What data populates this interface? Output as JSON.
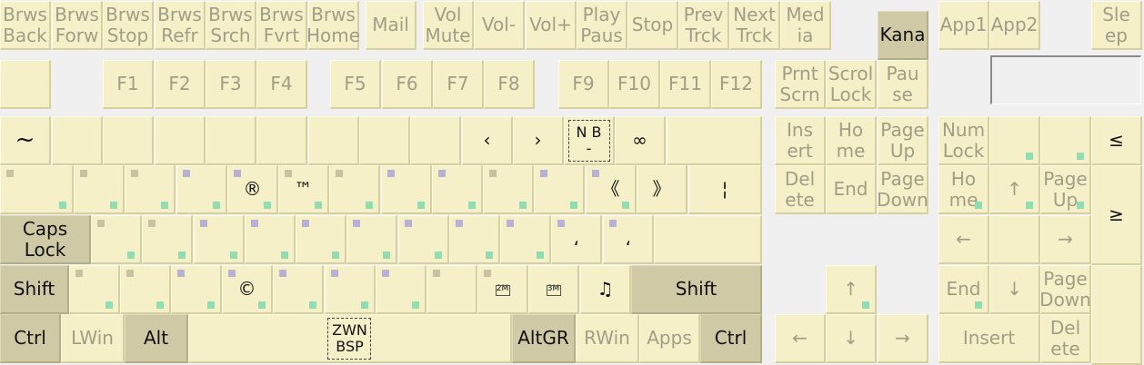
{
  "keys": [
    {
      "name": "browser-back-key",
      "label": "Brws\nBack"
    },
    {
      "name": "browser-forward-key",
      "label": "Brws\nForw"
    },
    {
      "name": "browser-stop-key",
      "label": "Brws\nStop"
    },
    {
      "name": "browser-refresh-key",
      "label": "Brws\nRefr"
    },
    {
      "name": "browser-search-key",
      "label": "Brws\nSrch"
    },
    {
      "name": "browser-favorites-key",
      "label": "Brws\nFvrt"
    },
    {
      "name": "browser-home-key",
      "label": "Brws\nHome"
    },
    {
      "name": "mail-key",
      "label": "Mail"
    },
    {
      "name": "volume-mute-key",
      "label": "Vol\nMute"
    },
    {
      "name": "volume-down-key",
      "label": "Vol-"
    },
    {
      "name": "volume-up-key",
      "label": "Vol+"
    },
    {
      "name": "play-pause-key",
      "label": "Play\nPaus"
    },
    {
      "name": "stop-key",
      "label": "Stop"
    },
    {
      "name": "previous-track-key",
      "label": "Prev\nTrck"
    },
    {
      "name": "next-track-key",
      "label": "Next\nTrck"
    },
    {
      "name": "media-key",
      "label": "Med\nia"
    },
    {
      "name": "kana-key",
      "label": "Kana",
      "dark": true
    },
    {
      "name": "app1-key",
      "label": "App1"
    },
    {
      "name": "app2-key",
      "label": "App2"
    },
    {
      "name": "sleep-key",
      "label": "Sle\nep"
    },
    {
      "name": "escape-key",
      "label": ""
    },
    {
      "name": "f1-key",
      "label": "F1"
    },
    {
      "name": "f2-key",
      "label": "F2"
    },
    {
      "name": "f3-key",
      "label": "F3"
    },
    {
      "name": "f4-key",
      "label": "F4"
    },
    {
      "name": "f5-key",
      "label": "F5"
    },
    {
      "name": "f6-key",
      "label": "F6"
    },
    {
      "name": "f7-key",
      "label": "F7"
    },
    {
      "name": "f8-key",
      "label": "F8"
    },
    {
      "name": "f9-key",
      "label": "F9"
    },
    {
      "name": "f10-key",
      "label": "F10"
    },
    {
      "name": "f11-key",
      "label": "F11"
    },
    {
      "name": "f12-key",
      "label": "F12"
    },
    {
      "name": "print-screen-key",
      "label": "Prnt\nScrn"
    },
    {
      "name": "scroll-lock-key",
      "label": "Scrol\nLock"
    },
    {
      "name": "pause-key",
      "label": "Pau\nse"
    },
    {
      "name": "grave-key",
      "label": "~",
      "black": true,
      "big": true
    },
    {
      "name": "digit1-key",
      "label": ""
    },
    {
      "name": "digit2-key",
      "label": ""
    },
    {
      "name": "digit3-key",
      "label": ""
    },
    {
      "name": "digit4-key",
      "label": ""
    },
    {
      "name": "digit5-key",
      "label": ""
    },
    {
      "name": "digit6-key",
      "label": ""
    },
    {
      "name": "digit7-key",
      "label": ""
    },
    {
      "name": "digit8-key",
      "label": ""
    },
    {
      "name": "digit9-key",
      "label": "‹",
      "black": true
    },
    {
      "name": "digit0-key",
      "label": "›",
      "black": true
    },
    {
      "name": "minus-key",
      "label": "N B\n-",
      "black": true,
      "dash": true
    },
    {
      "name": "equal-key",
      "label": "∞",
      "black": true
    },
    {
      "name": "backspace-key",
      "label": ""
    },
    {
      "name": "insert-key",
      "label": "Ins\nert"
    },
    {
      "name": "home-key",
      "label": "Ho\nme"
    },
    {
      "name": "page-up-key",
      "label": "Page\nUp"
    },
    {
      "name": "num-lock-key",
      "label": "Num\nLock"
    },
    {
      "name": "numpad-divide-key",
      "label": ""
    },
    {
      "name": "numpad-multiply-key",
      "label": ""
    },
    {
      "name": "numpad-minus-key",
      "label": "≤",
      "black": true
    },
    {
      "name": "tab-key",
      "label": ""
    },
    {
      "name": "q-key",
      "label": ""
    },
    {
      "name": "w-key",
      "label": ""
    },
    {
      "name": "e-key",
      "label": ""
    },
    {
      "name": "r-key",
      "label": "®",
      "black": true
    },
    {
      "name": "t-key",
      "label": "™",
      "black": true
    },
    {
      "name": "y-key",
      "label": ""
    },
    {
      "name": "u-key",
      "label": ""
    },
    {
      "name": "i-key",
      "label": ""
    },
    {
      "name": "o-key",
      "label": ""
    },
    {
      "name": "p-key",
      "label": ""
    },
    {
      "name": "bracket-left-key",
      "label": "《",
      "black": true
    },
    {
      "name": "bracket-right-key",
      "label": "》",
      "black": true
    },
    {
      "name": "backslash-key",
      "label": "¦",
      "black": true
    },
    {
      "name": "delete-key",
      "label": "Del\nete"
    },
    {
      "name": "end-key",
      "label": "End"
    },
    {
      "name": "page-down-key",
      "label": "Page\nDown"
    },
    {
      "name": "numpad-home-key",
      "label": "Ho\nme"
    },
    {
      "name": "numpad-up-key",
      "label": "↑"
    },
    {
      "name": "numpad-page-up-key",
      "label": "Page\nUp"
    },
    {
      "name": "numpad-plus-key",
      "label": "≥",
      "black": true
    },
    {
      "name": "caps-lock-key",
      "label": "Caps\nLock",
      "dark": true
    },
    {
      "name": "a-key",
      "label": ""
    },
    {
      "name": "s-key",
      "label": ""
    },
    {
      "name": "d-key",
      "label": ""
    },
    {
      "name": "f-key",
      "label": ""
    },
    {
      "name": "g-key",
      "label": ""
    },
    {
      "name": "h-key",
      "label": ""
    },
    {
      "name": "j-key",
      "label": ""
    },
    {
      "name": "k-key",
      "label": ""
    },
    {
      "name": "l-key",
      "label": ""
    },
    {
      "name": "semicolon-key",
      "label": "،",
      "black": true
    },
    {
      "name": "quote-key",
      "label": "،",
      "black": true
    },
    {
      "name": "enter-key",
      "label": ""
    },
    {
      "name": "numpad-left-key",
      "label": "←"
    },
    {
      "name": "numpad-5-key",
      "label": ""
    },
    {
      "name": "numpad-right-key",
      "label": "→"
    },
    {
      "name": "shift-left-key",
      "label": "Shift",
      "dark": true
    },
    {
      "name": "intl-backslash-key",
      "label": ""
    },
    {
      "name": "z-key",
      "label": ""
    },
    {
      "name": "x-key",
      "label": ""
    },
    {
      "name": "c-key",
      "label": "©",
      "black": true
    },
    {
      "name": "v-key",
      "label": ""
    },
    {
      "name": "b-key",
      "label": ""
    },
    {
      "name": "n-key",
      "label": ""
    },
    {
      "name": "m-key",
      "label": ""
    },
    {
      "name": "comma-key",
      "label": "2M",
      "black": true,
      "small": true
    },
    {
      "name": "period-key",
      "label": "3M",
      "black": true,
      "small": true
    },
    {
      "name": "slash-key",
      "label": "♫",
      "black": true
    },
    {
      "name": "shift-right-key",
      "label": "Shift",
      "dark": true
    },
    {
      "name": "arrow-up-key",
      "label": "↑"
    },
    {
      "name": "numpad-end-key",
      "label": "End"
    },
    {
      "name": "numpad-down-key",
      "label": "↓"
    },
    {
      "name": "numpad-page-down-key",
      "label": "Page\nDown"
    },
    {
      "name": "numpad-enter-key",
      "label": ""
    },
    {
      "name": "ctrl-left-key",
      "label": "Ctrl",
      "dark": true
    },
    {
      "name": "lwin-key",
      "label": "LWin"
    },
    {
      "name": "alt-key",
      "label": "Alt",
      "dark": true
    },
    {
      "name": "space-key",
      "label": "ZWN\nBSP",
      "black": true,
      "dash": true
    },
    {
      "name": "altgr-key",
      "label": "AltGR",
      "dark": true
    },
    {
      "name": "rwin-key",
      "label": "RWin"
    },
    {
      "name": "apps-key",
      "label": "Apps"
    },
    {
      "name": "ctrl-right-key",
      "label": "Ctrl",
      "dark": true
    },
    {
      "name": "arrow-left-key",
      "label": "←"
    },
    {
      "name": "arrow-down-key",
      "label": "↓"
    },
    {
      "name": "arrow-right-key",
      "label": "→"
    },
    {
      "name": "numpad-insert-key",
      "label": "Insert"
    },
    {
      "name": "numpad-delete-key",
      "label": "Del\nete"
    }
  ]
}
